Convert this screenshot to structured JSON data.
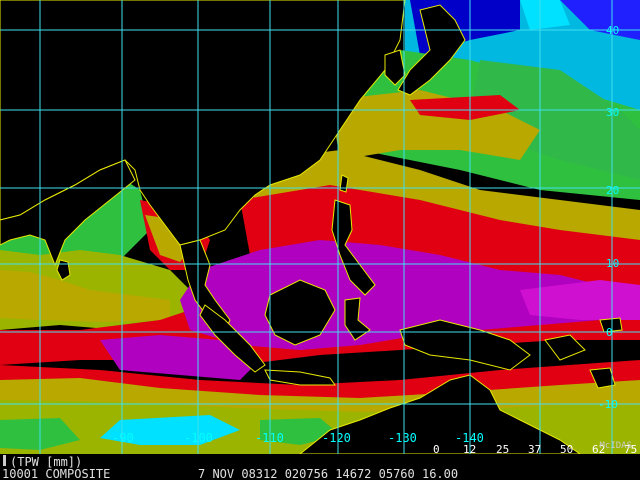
{
  "product": {
    "label": "(TPW [mm])",
    "frame": "10001 COMPOSITE",
    "timestamp": "7 NOV 08312 020756 14672 05760 16.00",
    "brand": "McIDAS"
  },
  "grid": {
    "lat_labels": [
      "40",
      "30",
      "20",
      "10",
      "0",
      "-10"
    ],
    "lon_labels": [
      "-90",
      "-100",
      "-110",
      "-120",
      "-130",
      "-140"
    ]
  },
  "legend": {
    "ticks": [
      "0",
      "12",
      "25",
      "37",
      "50",
      "62",
      "75"
    ],
    "colors": [
      "#0000c8",
      "#00d0ff",
      "#20c840",
      "#80c000",
      "#d8c800",
      "#e00010",
      "#cc00cc"
    ]
  },
  "palette": {
    "ocean_dry": "#0000c8",
    "cyan": "#00e0ff",
    "green": "#30c040",
    "yellow_green": "#9ab400",
    "yellow": "#b8a800",
    "red": "#e00012",
    "magenta": "#b000c0",
    "land": "#000000",
    "grid": "#40e0f0",
    "coast": "#e8e800"
  }
}
